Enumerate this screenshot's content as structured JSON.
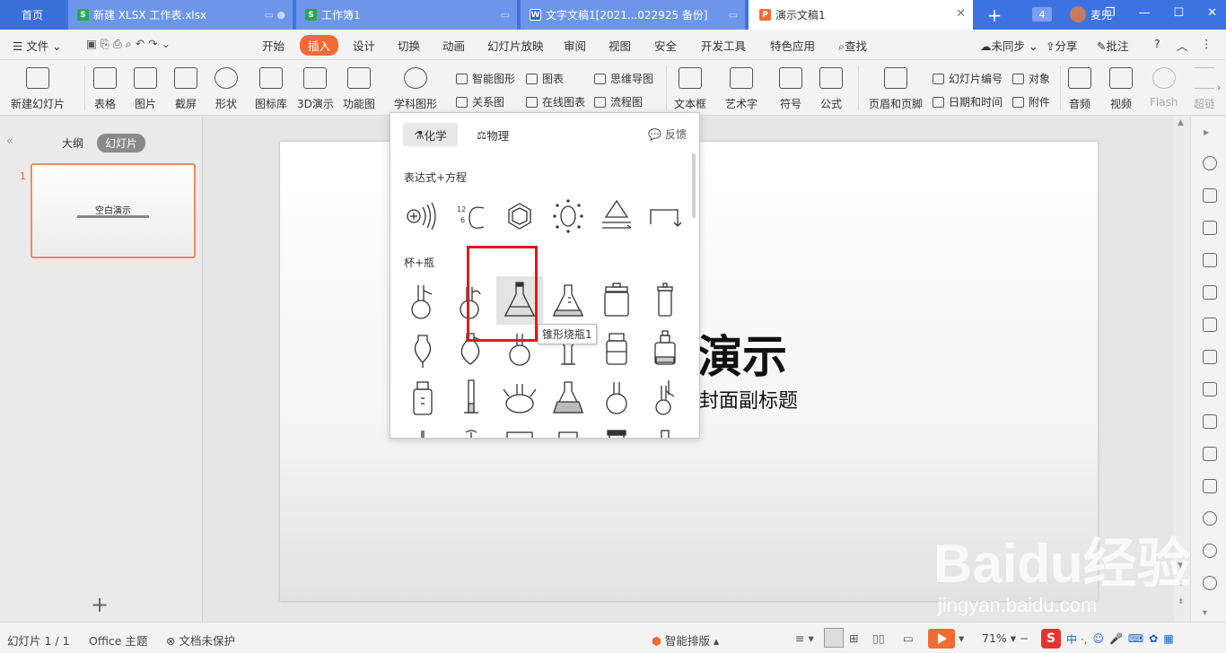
{
  "tabs": {
    "home": "首页",
    "t1": "新建 XLSX 工作表.xlsx",
    "t2": "工作簿1",
    "t3": "文字文稿1[2021...022925 备份]",
    "t4": "演示文稿1",
    "add": "+",
    "count": "4",
    "user": "麦兜"
  },
  "menu": {
    "file": "文件",
    "items": [
      "开始",
      "插入",
      "设计",
      "切换",
      "动画",
      "幻灯片放映",
      "审阅",
      "视图",
      "安全",
      "开发工具",
      "特色应用"
    ],
    "search": "查找",
    "sync": "未同步",
    "share": "分享",
    "comment": "批注",
    "help": "?"
  },
  "ribbon": {
    "new_slide": "新建幻灯片",
    "table": "表格",
    "picture": "图片",
    "screenshot": "截屏",
    "shape": "形状",
    "icon_lib": "图标库",
    "d3": "3D演示",
    "func_chart": "功能图",
    "subject_shape": "学科图形",
    "smart_shape": "智能图形",
    "chart": "图表",
    "mindmap": "思维导图",
    "relation": "关系图",
    "online_chart": "在线图表",
    "flowchart": "流程图",
    "textbox": "文本框",
    "wordart": "艺术字",
    "symbol": "符号",
    "formula": "公式",
    "header_footer": "页眉和页脚",
    "slide_number": "幻灯片编号",
    "object": "对象",
    "datetime": "日期和时间",
    "attachment": "附件",
    "audio": "音频",
    "video": "视频",
    "flash": "Flash",
    "hyperlink": "超链"
  },
  "left_panel": {
    "outline": "大纲",
    "slides": "幻灯片",
    "slide_number": "1",
    "thumb_title": "空白演示"
  },
  "slide": {
    "title_visible": "演示",
    "subtitle_visible": "封面副标题"
  },
  "dropdown": {
    "tab_chem": "化学",
    "tab_phys": "物理",
    "feedback": "反馈",
    "section1": "表达式+方程",
    "section2": "杯+瓶",
    "tooltip": "锥形烧瓶1"
  },
  "status": {
    "slide_count": "幻灯片 1 / 1",
    "theme": "Office 主题",
    "protect": "文档未保护",
    "smart_layout": "智能排版",
    "zoom": "71%"
  },
  "watermark": {
    "brand": "Baidu经验",
    "url": "jingyan.baidu.com"
  }
}
